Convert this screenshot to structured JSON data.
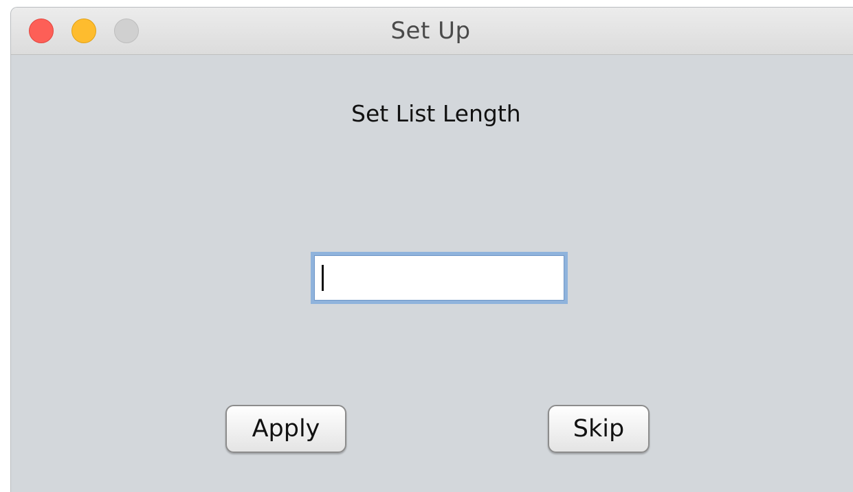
{
  "window": {
    "title": "Set Up"
  },
  "dialog": {
    "heading": "Set List Length",
    "input_value": ""
  },
  "buttons": {
    "apply_label": "Apply",
    "skip_label": "Skip"
  },
  "colors": {
    "window_background": "#d3d7db",
    "close": "#fd5f57",
    "minimize": "#febc2e",
    "zoom_disabled": "#d0d0d0",
    "focus_ring": "#8fb3dc"
  },
  "icons": [
    "close-window-icon",
    "minimize-window-icon",
    "zoom-window-icon"
  ]
}
